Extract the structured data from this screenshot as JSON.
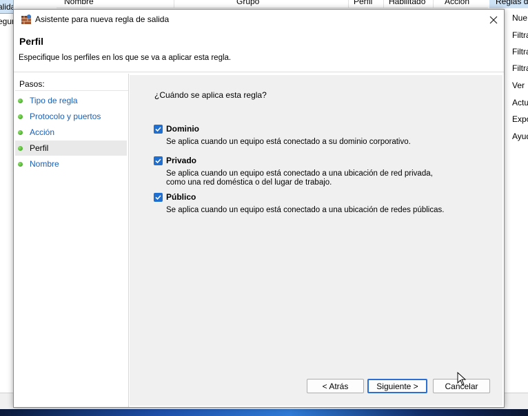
{
  "background": {
    "left_item_1": "alida",
    "left_item_2": "eguri",
    "columns": [
      "Nombre",
      "Grupo",
      "Perfil",
      "Habilitado",
      "Acción"
    ],
    "actions_title": "Reglas de",
    "actions": [
      "Nue",
      "Filtra",
      "Filtra",
      "Filtra",
      "Ver",
      "Actu",
      "Expo",
      "Ayud"
    ]
  },
  "dialog": {
    "title": "Asistente para nueva regla de salida",
    "close_icon": "close-icon",
    "page_title": "Perfil",
    "page_description": "Especifique los perfiles en los que se va a aplicar esta regla.",
    "steps_title": "Pasos:",
    "steps": [
      {
        "label": "Tipo de regla",
        "current": false
      },
      {
        "label": "Protocolo y puertos",
        "current": false
      },
      {
        "label": "Acción",
        "current": false
      },
      {
        "label": "Perfil",
        "current": true
      },
      {
        "label": "Nombre",
        "current": false
      }
    ],
    "question": "¿Cuándo se aplica esta regla?",
    "options": [
      {
        "label": "Dominio",
        "checked": true,
        "description": "Se aplica cuando un equipo está conectado a su dominio corporativo."
      },
      {
        "label": "Privado",
        "checked": true,
        "description": "Se aplica cuando un equipo está conectado a una ubicación de red privada, como una red doméstica o del lugar de trabajo."
      },
      {
        "label": "Público",
        "checked": true,
        "description": "Se aplica cuando un equipo está conectado a una ubicación de redes públicas."
      }
    ],
    "buttons": {
      "back": "< Atrás",
      "next": "Siguiente >",
      "cancel": "Cancelar"
    },
    "colors": {
      "accent": "#1f6fd0",
      "step_link": "#1a5fb4",
      "step_dot": "#2f9b14"
    }
  }
}
